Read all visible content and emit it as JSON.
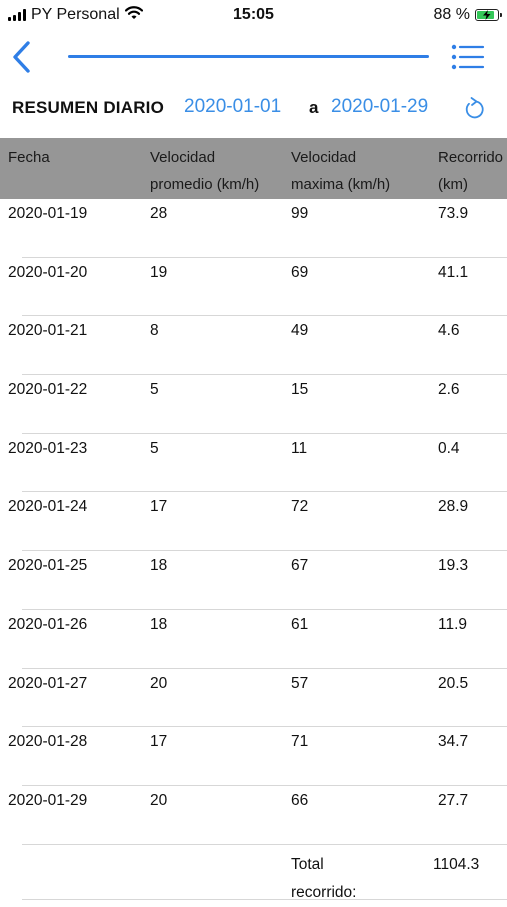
{
  "status_bar": {
    "carrier": "PY Personal",
    "time": "15:05",
    "battery": "88 %",
    "battery_level": 0.88,
    "battery_color": "#34c759",
    "icons": [
      "signal-icon",
      "wifi-icon",
      "battery-icon"
    ]
  },
  "nav": {
    "icons": [
      "back-chevron-icon",
      "list-menu-icon"
    ],
    "accent": "#2f7ee6",
    "progress": 1.0
  },
  "summary": {
    "title": "RESUMEN DIARIO",
    "date_from": "2020-01-01",
    "separator": "a",
    "date_to": "2020-01-29",
    "refresh_icon": "refresh-icon",
    "date_color": "#3a8ee6"
  },
  "table": {
    "header_color": "#969696",
    "columns": [
      "Fecha",
      "Velocidad\npromedio (km/h)",
      "Velocidad\n maxima (km/h)",
      "Recorrido\n(km)"
    ],
    "rows": [
      [
        "2020-01-19",
        "28",
        "99",
        "73.9"
      ],
      [
        "2020-01-20",
        "19",
        "69",
        "41.1"
      ],
      [
        "2020-01-21",
        "8",
        "49",
        "4.6"
      ],
      [
        "2020-01-22",
        "5",
        "15",
        "2.6"
      ],
      [
        "2020-01-23",
        "5",
        "11",
        "0.4"
      ],
      [
        "2020-01-24",
        "17",
        "72",
        "28.9"
      ],
      [
        "2020-01-25",
        "18",
        "67",
        "19.3"
      ],
      [
        "2020-01-26",
        "18",
        "61",
        "11.9"
      ],
      [
        "2020-01-27",
        "20",
        "57",
        "20.5"
      ],
      [
        "2020-01-28",
        "17",
        "71",
        "34.7"
      ],
      [
        "2020-01-29",
        "20",
        "66",
        "27.7"
      ]
    ],
    "total_label": "Total\nrecorrido:",
    "total_value": "1104.3"
  }
}
